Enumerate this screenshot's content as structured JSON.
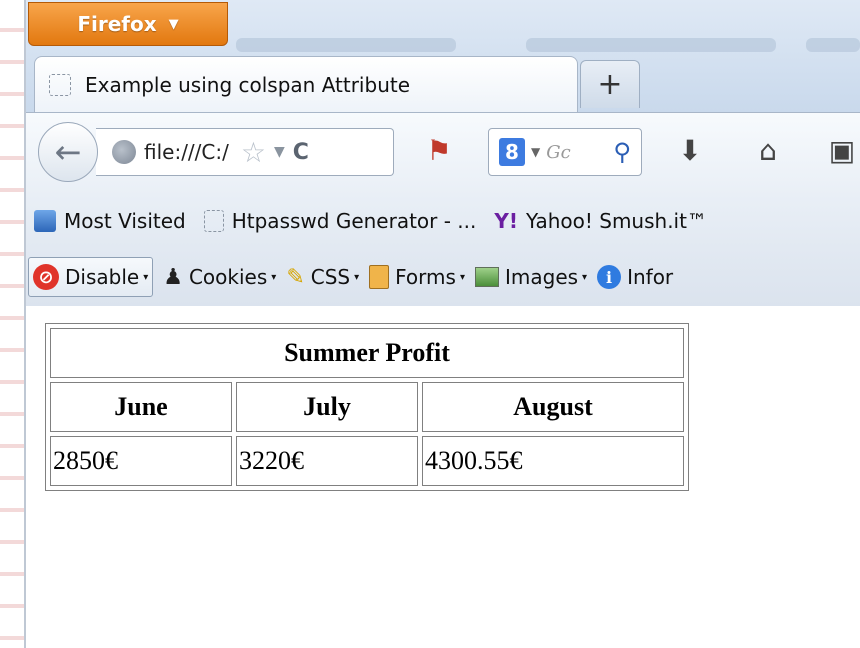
{
  "browser": {
    "menu_button": "Firefox",
    "tab_title": "Example using colspan Attribute",
    "new_tab": "+",
    "url": "file:///C:/",
    "search_placeholder": "Gc"
  },
  "bookmarks": [
    {
      "label": "Most Visited",
      "icon": "most-visited-icon"
    },
    {
      "label": "Htpasswd Generator - ...",
      "icon": "page-icon"
    },
    {
      "label": "Yahoo! Smush.it™",
      "icon": "yahoo-icon"
    }
  ],
  "devtoolbar": {
    "disable": "Disable",
    "cookies": "Cookies",
    "css": "CSS",
    "forms": "Forms",
    "images": "Images",
    "information": "Infor"
  },
  "table": {
    "caption_header": "Summer Profit",
    "columns": [
      "June",
      "July",
      "August"
    ],
    "rows": [
      [
        "2850€",
        "3220€",
        "4300.55€"
      ]
    ]
  },
  "colors": {
    "firefox_orange": "#e2780f",
    "chrome_blue": "#dfe9f5"
  }
}
